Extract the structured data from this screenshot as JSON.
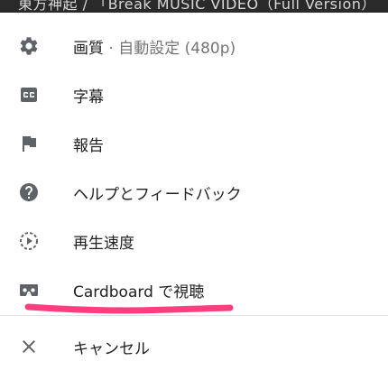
{
  "background": {
    "partial_title": "東方神起 / 「Break MUSIC VIDEO（Full Version）"
  },
  "menu": {
    "items": [
      {
        "label": "画質",
        "separator": " · ",
        "secondary": "自動設定 (480p)",
        "icon": "gear-icon"
      },
      {
        "label": "字幕",
        "icon": "closed-captions-icon"
      },
      {
        "label": "報告",
        "icon": "flag-icon"
      },
      {
        "label": "ヘルプとフィードバック",
        "icon": "help-icon"
      },
      {
        "label": "再生速度",
        "icon": "playback-speed-icon"
      },
      {
        "label": "Cardboard で視聴",
        "icon": "cardboard-icon"
      }
    ],
    "cancel": {
      "label": "キャンセル",
      "icon": "close-icon"
    }
  },
  "colors": {
    "icon": "#5f6368",
    "text": "#212121",
    "secondary_text": "#757575",
    "annotation_highlight": "#ff3d7f",
    "divider": "#e0e0e0"
  }
}
